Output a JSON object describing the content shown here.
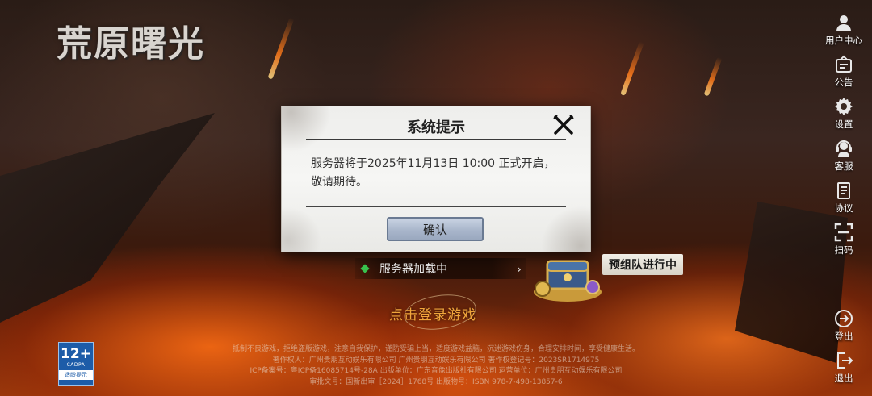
{
  "game": {
    "logo_text": "荒原曙光"
  },
  "sidebar": {
    "top_items": [
      {
        "label": "用户中心",
        "icon": "user-icon"
      },
      {
        "label": "公告",
        "icon": "announcement-icon"
      },
      {
        "label": "设置",
        "icon": "gear-icon"
      },
      {
        "label": "客服",
        "icon": "headset-icon"
      },
      {
        "label": "协议",
        "icon": "document-icon"
      },
      {
        "label": "扫码",
        "icon": "scan-icon"
      }
    ],
    "bottom_items": [
      {
        "label": "登出",
        "icon": "logout-icon"
      },
      {
        "label": "退出",
        "icon": "exit-icon"
      }
    ]
  },
  "dialog": {
    "title": "系统提示",
    "message_line1": "服务器将于2025年11月13日 10:00 正式开启，",
    "message_line2": "敬请期待。",
    "confirm_label": "确认"
  },
  "server": {
    "status_text": "服务器加载中"
  },
  "promo": {
    "label": "预组队进行中"
  },
  "login": {
    "tap_label": "点击登录游戏"
  },
  "footer": {
    "line1": "抵制不良游戏，拒绝盗版游戏，注意自我保护，谨防受骗上当，适度游戏益脑，沉迷游戏伤身，合理安排时间，享受健康生活。",
    "line2": "著作权人：广州贵朋互动娱乐有限公司    广州贵朋互动娱乐有限公司    著作权登记号：2023SR1714975",
    "line3": "ICP备案号：粤ICP备16085714号-28A    出版单位：广东音像出版社有限公司    运营单位：广州贵朋互动娱乐有限公司",
    "line4": "审批文号：国新出审［2024］1768号    出版物号：ISBN 978-7-498-13857-6"
  },
  "age_rating": {
    "value": "12+",
    "org": "CADPA",
    "tip": "适龄提示"
  },
  "colors": {
    "accent_orange": "#f0a63c",
    "server_dot": "#38c14d",
    "confirm_button": "#a9b6cb"
  }
}
